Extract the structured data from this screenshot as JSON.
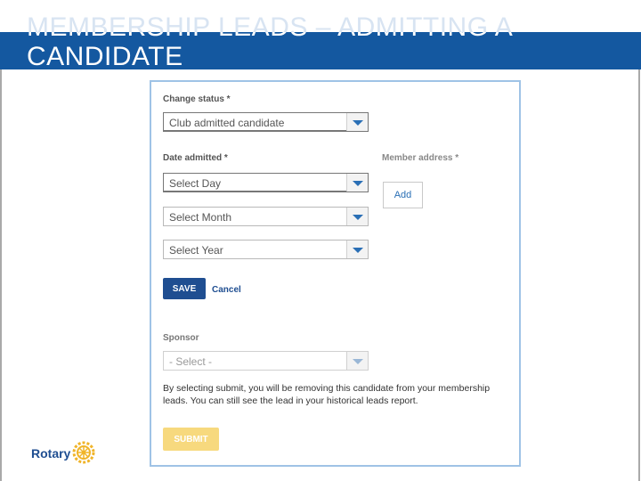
{
  "slide": {
    "title": "MEMBERSHIP LEADS – ADMITTING A CANDIDATE"
  },
  "form": {
    "change_status_label": "Change status *",
    "change_status_value": "Club admitted candidate",
    "date_admitted_label": "Date admitted *",
    "day_value": "Select Day",
    "month_value": "Select Month",
    "year_value": "Select Year",
    "member_address_label": "Member address *",
    "add_label": "Add",
    "save_label": "SAVE",
    "cancel_label": "Cancel",
    "sponsor_label": "Sponsor",
    "sponsor_value": "- Select -",
    "note": "By selecting submit, you will be removing this candidate from your membership leads. You can still see the lead in your historical leads report.",
    "submit_label": "SUBMIT"
  },
  "logo": {
    "text": "Rotary"
  },
  "colors": {
    "title_bar": "#1458a0",
    "save_button": "#1f4e91",
    "submit_button": "#f7d97e",
    "panel_border": "#9fc3e6"
  }
}
